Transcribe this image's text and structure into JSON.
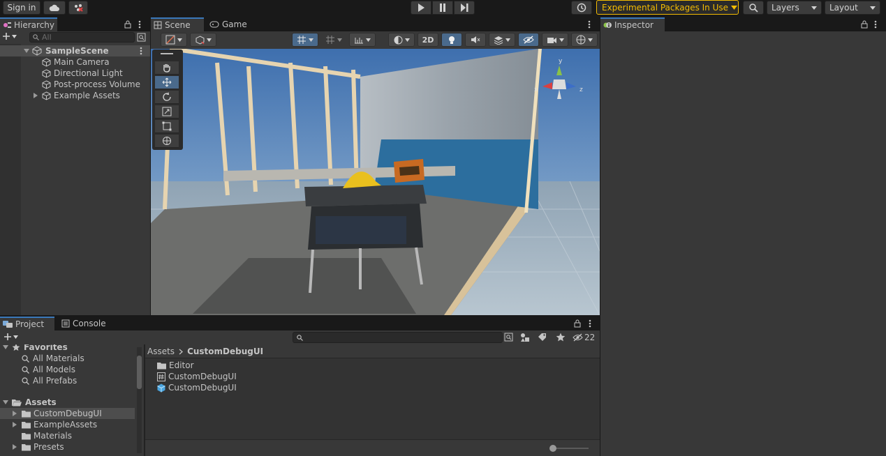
{
  "toolbar": {
    "sign_in": "Sign in",
    "experimental": "Experimental Packages In Use",
    "layers": "Layers",
    "layout": "Layout"
  },
  "hierarchy": {
    "tab": "Hierarchy",
    "search_placeholder": "All",
    "scene": "SampleScene",
    "items": [
      "Main Camera",
      "Directional Light",
      "Post-process Volume",
      "Example Assets"
    ]
  },
  "scene_view": {
    "tabs": [
      "Scene",
      "Game"
    ],
    "mode_2d": "2D",
    "gizmo_axes": [
      "y",
      "x",
      "z"
    ]
  },
  "inspector": {
    "tab": "Inspector"
  },
  "project": {
    "tabs": [
      "Project",
      "Console"
    ],
    "search_placeholder": "",
    "hidden_count": "22",
    "favorites_label": "Favorites",
    "favorites": [
      "All Materials",
      "All Models",
      "All Prefabs"
    ],
    "assets_label": "Assets",
    "asset_folders": [
      "CustomDebugUI",
      "ExampleAssets",
      "Materials",
      "Presets"
    ],
    "breadcrumb": [
      "Assets",
      "CustomDebugUI"
    ],
    "files": [
      "Editor",
      "CustomDebugUI",
      "CustomDebugUI"
    ]
  },
  "colors": {
    "accent": "#3a79bb",
    "warning": "#f4bc02",
    "selection": "#4d4d4d"
  }
}
